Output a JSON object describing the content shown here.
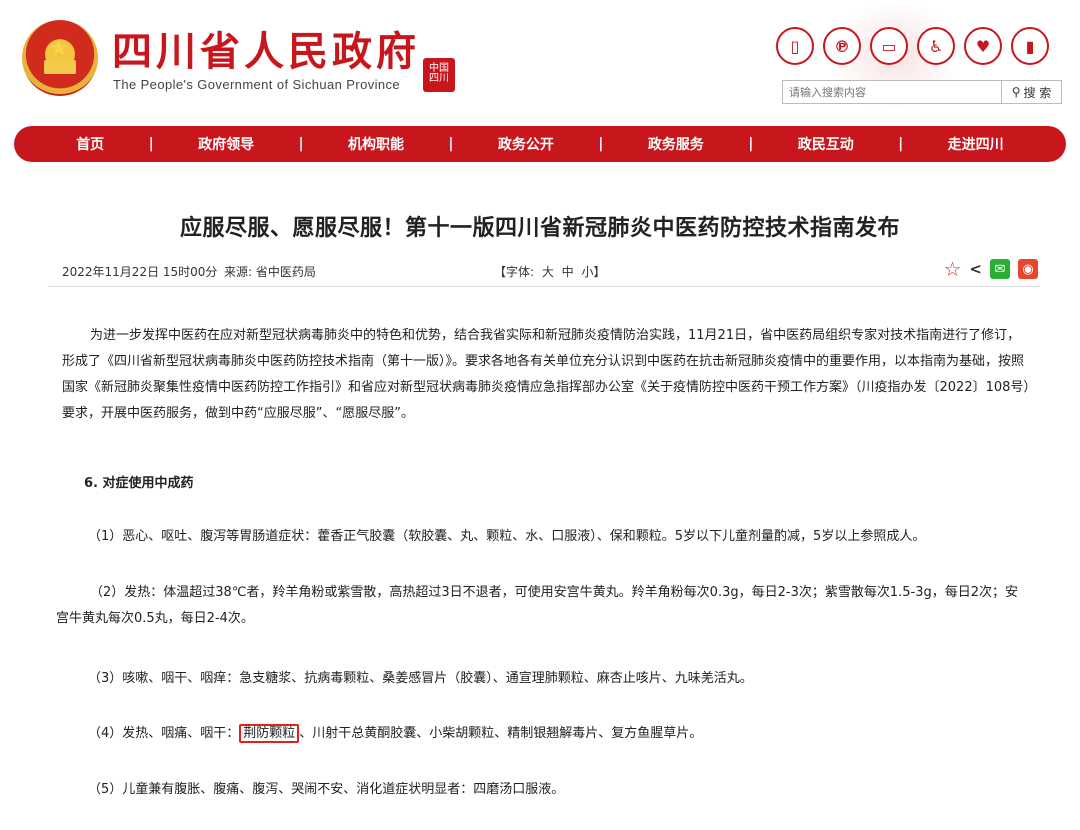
{
  "header": {
    "title": "四川省人民政府",
    "subtitle": "The People's Government of Sichuan Province",
    "seal_text": "中国四川",
    "icons": [
      "phone-icon",
      "pinterest-icon",
      "message-icon",
      "accessibility-icon",
      "elderly-icon",
      "exit-icon"
    ],
    "search": {
      "placeholder": "请输入搜索内容",
      "button_label": "搜 索"
    }
  },
  "nav": {
    "items": [
      "首页",
      "政府领导",
      "机构职能",
      "政务公开",
      "政务服务",
      "政民互动",
      "走进四川"
    ],
    "separator": "|"
  },
  "article": {
    "title": "应服尽服、愿服尽服！第十一版四川省新冠肺炎中医药防控技术指南发布",
    "date": "2022年11月22日 15时00分",
    "source": "来源: 省中医药局",
    "font_size_control": "【字体: 大 中 小】",
    "intro": "为进一步发挥中医药在应对新型冠状病毒肺炎中的特色和优势，结合我省实际和新冠肺炎疫情防治实践，11月21日，省中医药局组织专家对技术指南进行了修订，形成了《四川省新型冠状病毒肺炎中医药防控技术指南（第十一版）》。要求各地各有关单位充分认识到中医药在抗击新冠肺炎疫情中的重要作用，以本指南为基础，按照国家《新冠肺炎聚集性疫情中医药防控工作指引》和省应对新型冠状病毒肺炎疫情应急指挥部办公室《关于疫情防控中医药干预工作方案》（川疫指办发〔2022〕108号）要求，开展中医药服务，做到中药“应服尽服”、“愿服尽服”。",
    "section_heading": "6. 对症使用中成药",
    "item1": "（1）恶心、呕吐、腹泻等胃肠道症状：藿香正气胶囊（软胶囊、丸、颗粒、水、口服液）、保和颗粒。5岁以下儿童剂量酌减，5岁以上参照成人。",
    "item2": "（2）发热：体温超过38℃者，羚羊角粉或紫雪散，高热超过3日不退者，可使用安宫牛黄丸。羚羊角粉每次0.3g，每日2-3次；紫雪散每次1.5-3g，每日2次；安宫牛黄丸每次0.5丸，每日2-4次。",
    "item3": "（3）咳嗽、咽干、咽痒：急支糖浆、抗病毒颗粒、桑姜感冒片（胶囊）、通宣理肺颗粒、麻杏止咳片、九味羌活丸。",
    "item4_prefix": "（4）发热、咽痛、咽干：",
    "item4_highlight": "荆防颗粒",
    "item4_suffix": "、川射干总黄酮胶囊、小柴胡颗粒、精制银翘解毒片、复方鱼腥草片。",
    "item5": "（5）儿童兼有腹胀、腹痛、腹泻、哭闹不安、消化道症状明显者：四磨汤口服液。"
  },
  "colors": {
    "brand_red": "#c8161d",
    "highlight_border": "#e0221b"
  }
}
